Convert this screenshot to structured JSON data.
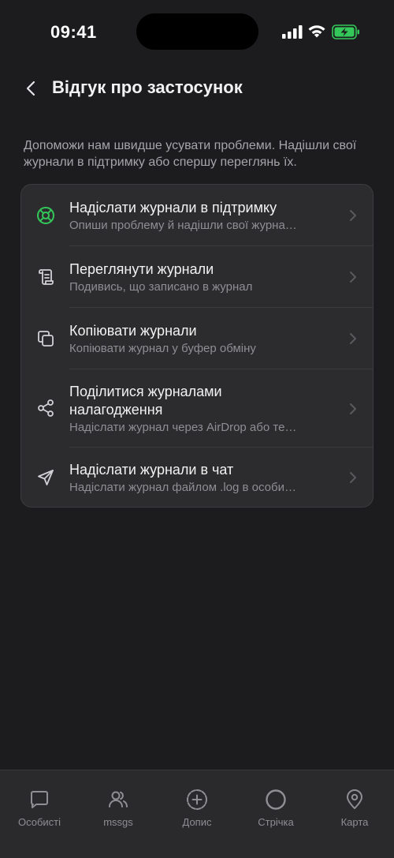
{
  "status": {
    "time": "09:41"
  },
  "header": {
    "title": "Відгук про застосунок"
  },
  "description": "Допоможи нам швидше усувати проблеми. Надішли свої журнали в підтримку або спершу переглянь їх.",
  "items": [
    {
      "title": "Надіслати журнали в підтримку",
      "subtitle": "Опиши проблему й надішли свої журна…",
      "icon": "lifebuoy-icon",
      "accent": "#34c759"
    },
    {
      "title": "Переглянути журнали",
      "subtitle": "Подивись, що записано в журнал",
      "icon": "scroll-icon"
    },
    {
      "title": "Копіювати журнали",
      "subtitle": "Копіювати журнал у буфер обміну",
      "icon": "copy-icon"
    },
    {
      "title_line1": "Поділитися журналами",
      "title_line2": "налагодження",
      "subtitle": "Надіслати журнал через AirDrop або те…",
      "icon": "share-icon"
    },
    {
      "title": "Надіслати журнали в чат",
      "subtitle": "Надіслати журнал файлом .log в особи…",
      "icon": "send-icon"
    }
  ],
  "tabs": [
    {
      "label": "Особисті",
      "icon": "chat-bubble-icon"
    },
    {
      "label": "mssgs",
      "icon": "people-icon"
    },
    {
      "label": "Допис",
      "icon": "plus-circle-icon"
    },
    {
      "label": "Стрічка",
      "icon": "circle-feed-icon"
    },
    {
      "label": "Карта",
      "icon": "map-pin-icon"
    }
  ],
  "colors": {
    "background": "#1c1c1e",
    "card": "#2c2c2e",
    "accent_green": "#34c759",
    "secondary_text": "#8e8e93"
  }
}
